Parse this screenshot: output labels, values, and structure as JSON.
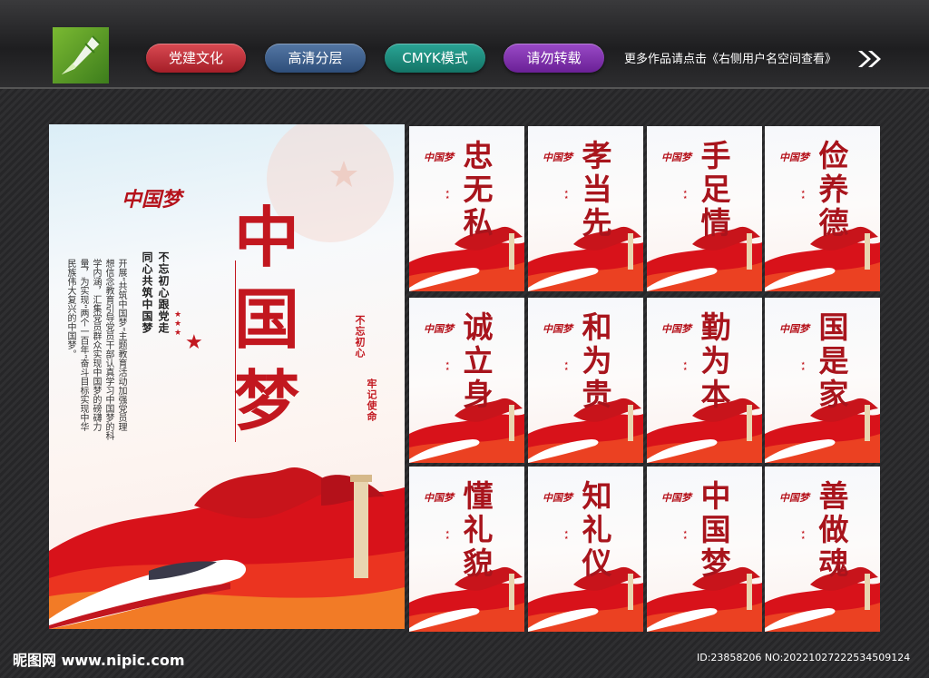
{
  "header": {
    "tags": [
      "党建文化",
      "高清分层",
      "CMYK模式",
      "请勿转载"
    ],
    "more_text": "更多作品请点击《右侧用户名空间查看》"
  },
  "main_poster": {
    "title_chars": [
      "中",
      "国",
      "梦"
    ],
    "logo_text": "中国梦",
    "subtitle_1": "不忘初心跟党走",
    "subtitle_2": "同心共筑中国梦",
    "body_text": "开展“共筑中国梦”主题教育活动加强党员理想信念教育引导党员干部认真学习中国梦的科学内涵，汇集党员群众实现中国梦的磅礴力量，为实现“两个一百年”奋斗目标实现中华民族伟大复兴的中国梦。",
    "slogan_1": "不忘初心",
    "slogan_2": "牢记使命"
  },
  "small_posters": [
    {
      "title": [
        "忠",
        "无",
        "私"
      ]
    },
    {
      "title": [
        "孝",
        "当",
        "先"
      ]
    },
    {
      "title": [
        "手",
        "足",
        "情"
      ]
    },
    {
      "title": [
        "俭",
        "养",
        "德"
      ]
    },
    {
      "title": [
        "诚",
        "立",
        "身"
      ]
    },
    {
      "title": [
        "和",
        "为",
        "贵"
      ]
    },
    {
      "title": [
        "勤",
        "为",
        "本"
      ]
    },
    {
      "title": [
        "国",
        "是",
        "家"
      ]
    },
    {
      "title": [
        "懂",
        "礼",
        "貌"
      ]
    },
    {
      "title": [
        "知",
        "礼",
        "仪"
      ]
    },
    {
      "title": [
        "中",
        "国",
        "梦"
      ]
    },
    {
      "title": [
        "善",
        "做",
        "魂"
      ]
    }
  ],
  "small_logo_text": "中国梦",
  "footer": {
    "brand": "昵图网 www.nipic.com",
    "id_text": "ID:23858206 NO:20221027222534509124"
  },
  "colors": {
    "accent_red": "#c2171f",
    "pill_red": "#b8262f",
    "pill_blue": "#3d5f8e",
    "pill_teal": "#1a8a7c",
    "pill_purple": "#7c2eab"
  }
}
